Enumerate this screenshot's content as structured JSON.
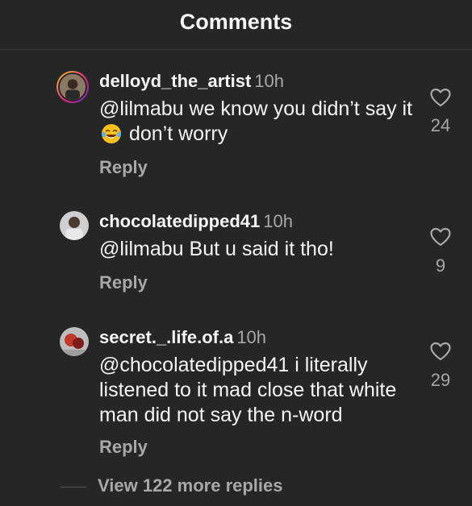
{
  "header": {
    "title": "Comments"
  },
  "comments": [
    {
      "username": "delloyd_the_artist",
      "time": "10h",
      "text_before": "@lilmabu we know you didn’t say it",
      "emoji": "face-with-tears-of-joy-icon",
      "text_after": "don’t worry",
      "reply_label": "Reply",
      "likes": "24"
    },
    {
      "username": "chocolatedipped41",
      "time": "10h",
      "text": "@lilmabu But u said it tho!",
      "reply_label": "Reply",
      "likes": "9"
    },
    {
      "username": "secret._.life.of.a",
      "time": "10h",
      "text": "@chocolatedipped41 i literally listened to it mad close that white man did not say the n-word",
      "reply_label": "Reply",
      "likes": "29"
    }
  ],
  "view_more": {
    "label": "View 122 more replies"
  },
  "colors": {
    "background": "#262626",
    "text": "#f5f5f5",
    "secondary": "#a8a8a8",
    "story_ring_start": "#f9ce34",
    "story_ring_end": "#6228d7"
  }
}
